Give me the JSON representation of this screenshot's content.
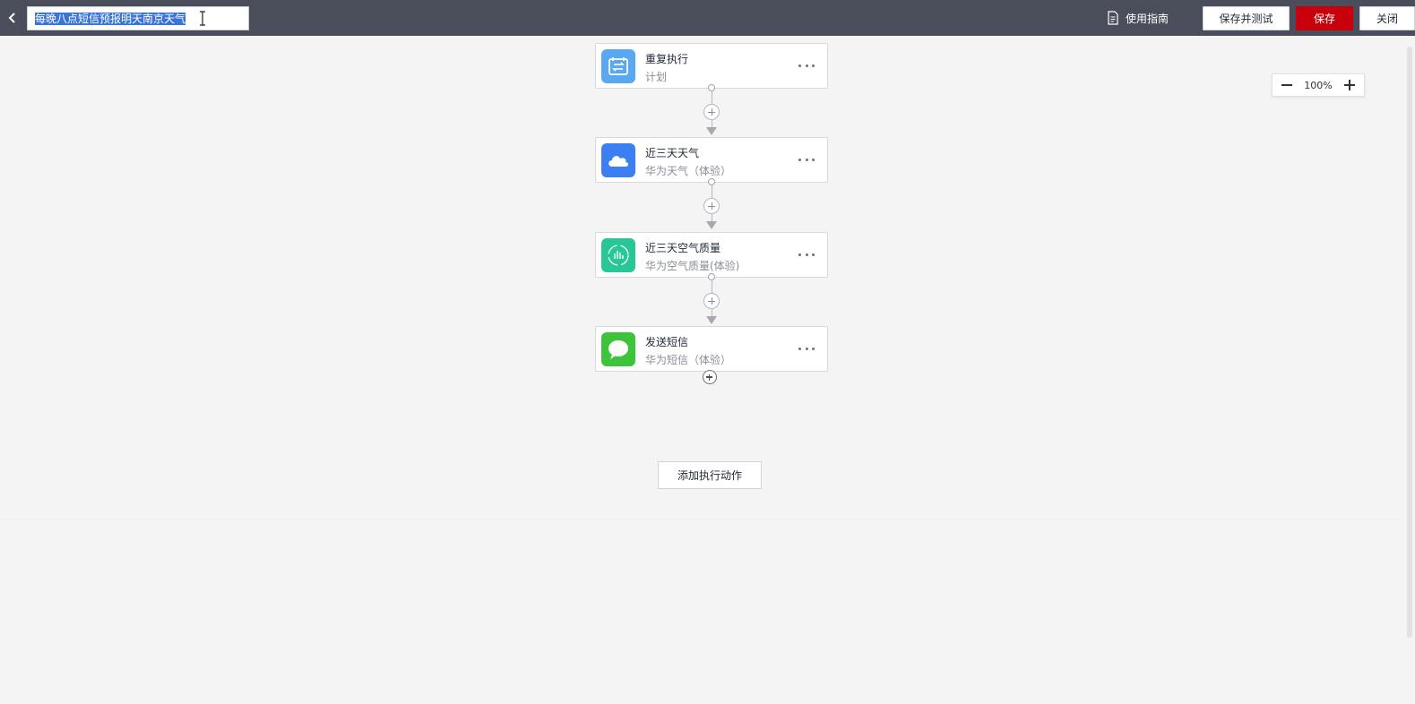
{
  "header": {
    "flow_title": "每晚八点短信预报明天南京天气",
    "guide_label": "使用指南",
    "save_test_label": "保存并测试",
    "save_label": "保存",
    "close_label": "关闭"
  },
  "zoom": {
    "value": "100%"
  },
  "steps": [
    {
      "title": "重复执行",
      "subtitle": "计划",
      "icon": "calendar-icon",
      "color": "#5aa8f4"
    },
    {
      "title": "近三天天气",
      "subtitle": "华为天气（体验）",
      "icon": "cloud-icon",
      "color": "#3b7ff2"
    },
    {
      "title": "近三天空气质量",
      "subtitle": "华为空气质量(体验)",
      "icon": "air-quality-icon",
      "color": "#27c79a"
    },
    {
      "title": "发送短信",
      "subtitle": "华为短信（体验）",
      "icon": "message-icon",
      "color": "#3ec43b"
    }
  ],
  "add_action_label": "添加执行动作",
  "colors": {
    "topbar": "#4a4e5a",
    "primary": "#c7000b",
    "selection": "#3b74d9"
  }
}
